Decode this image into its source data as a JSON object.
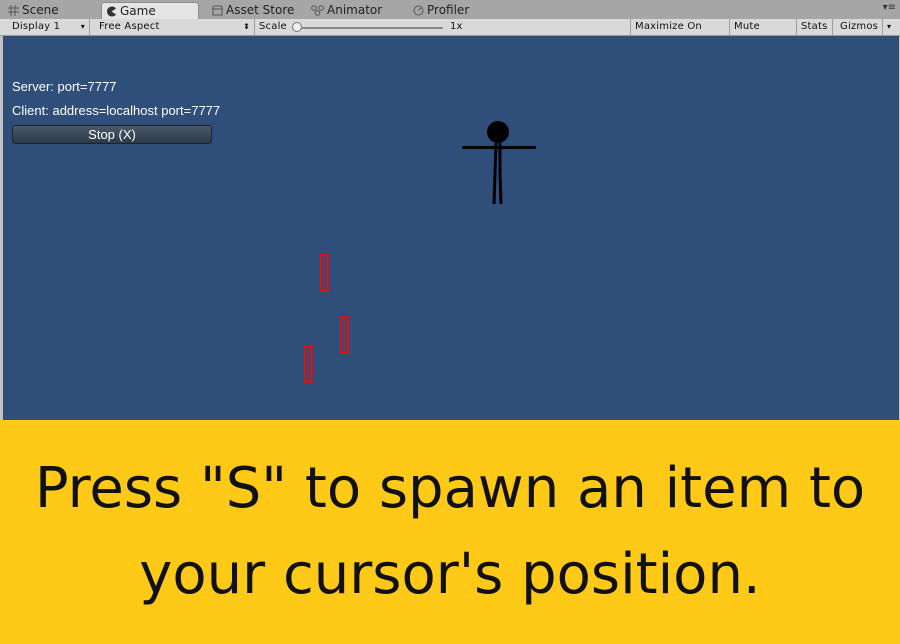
{
  "tabs": [
    {
      "label": "Scene",
      "icon": "grid-icon"
    },
    {
      "label": "Game",
      "icon": "pacman-icon",
      "active": true
    },
    {
      "label": "Asset Store",
      "icon": "store-icon"
    },
    {
      "label": "Animator",
      "icon": "animator-icon"
    },
    {
      "label": "Profiler",
      "icon": "profiler-icon"
    }
  ],
  "toolbar": {
    "display": "Display 1",
    "aspect": "Free Aspect",
    "scale_label": "Scale",
    "scale_value": "1x",
    "maximize": "Maximize On Play",
    "mute": "Mute Audio",
    "stats": "Stats",
    "gizmos": "Gizmos"
  },
  "hud": {
    "server": "Server: port=7777",
    "client": "Client: address=localhost port=7777",
    "stop_button": "Stop (X)"
  },
  "banner": {
    "line1": "Press \"S\" to spawn an item to",
    "line2": "your cursor's position."
  },
  "colors": {
    "game_bg": "#304e7a",
    "banner_bg": "#fec917",
    "item_red": "#e01010"
  }
}
